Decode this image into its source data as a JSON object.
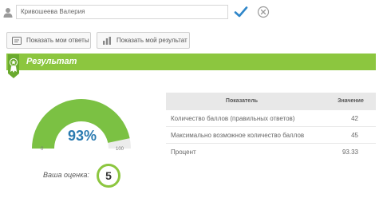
{
  "topbar": {
    "name_value": "Кривошеева Валерия",
    "user_icon": "user-icon",
    "confirm_icon": "checkmark-icon",
    "cancel_icon": "close-circle-icon"
  },
  "actions": {
    "show_answers_label": "Показать мои ответы",
    "show_result_label": "Показать мой результат"
  },
  "result": {
    "title": "Результат",
    "accent_color": "#8cc63f"
  },
  "gauge": {
    "value_text": "93%",
    "fraction": 0.9333,
    "min_label": "0",
    "max_label": "100",
    "fill_color": "#7bc143",
    "track_color": "#ececec"
  },
  "grade": {
    "label": "Ваша оценка:",
    "value": "5"
  },
  "table": {
    "header_name": "Показатель",
    "header_value": "Значение",
    "rows": [
      {
        "name": "Количество баллов (правильных ответов)",
        "value": "42"
      },
      {
        "name": "Максимально возможное количество баллов",
        "value": "45"
      },
      {
        "name": "Процент",
        "value": "93.33"
      }
    ]
  }
}
